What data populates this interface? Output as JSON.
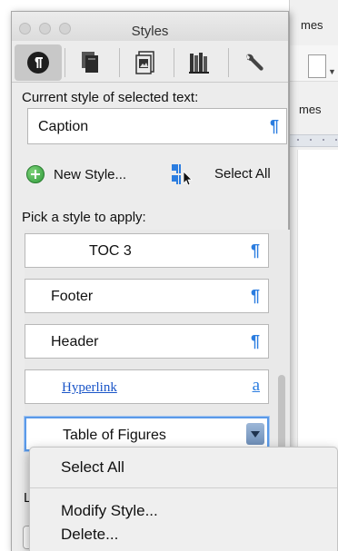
{
  "background_window": {
    "tab_label": "mes",
    "ribbon_label": "mes"
  },
  "panel": {
    "title": "Styles",
    "toolbar": [
      {
        "icon": "paragraph-styles-icon"
      },
      {
        "icon": "document-layers-icon"
      },
      {
        "icon": "media-browser-icon"
      },
      {
        "icon": "books-icon"
      },
      {
        "icon": "wrench-icon"
      }
    ],
    "current_style_label": "Current style of selected text:",
    "current_style_value": "Caption",
    "paragraph_mark": "¶",
    "new_style_label": "New Style...",
    "select_all_label": "Select All",
    "pick_label": "Pick a style to apply:",
    "styles": [
      {
        "name": "TOC 3",
        "mark": "¶",
        "type": "paragraph"
      },
      {
        "name": "Footer",
        "mark": "¶",
        "type": "paragraph"
      },
      {
        "name": "Header",
        "mark": "¶",
        "type": "paragraph"
      },
      {
        "name": "Hyperlink",
        "mark": "a",
        "type": "character"
      },
      {
        "name": "Table of Figures",
        "mark": "",
        "type": "paragraph",
        "selected": true
      }
    ],
    "footer_label": "L"
  },
  "context_menu": {
    "items": [
      "Select All",
      "Modify Style...",
      "Delete..."
    ]
  },
  "colors": {
    "paragraph_mark": "#2b7de0",
    "hyperlink": "#1a55c8",
    "selection_border": "#5b9ae8"
  }
}
